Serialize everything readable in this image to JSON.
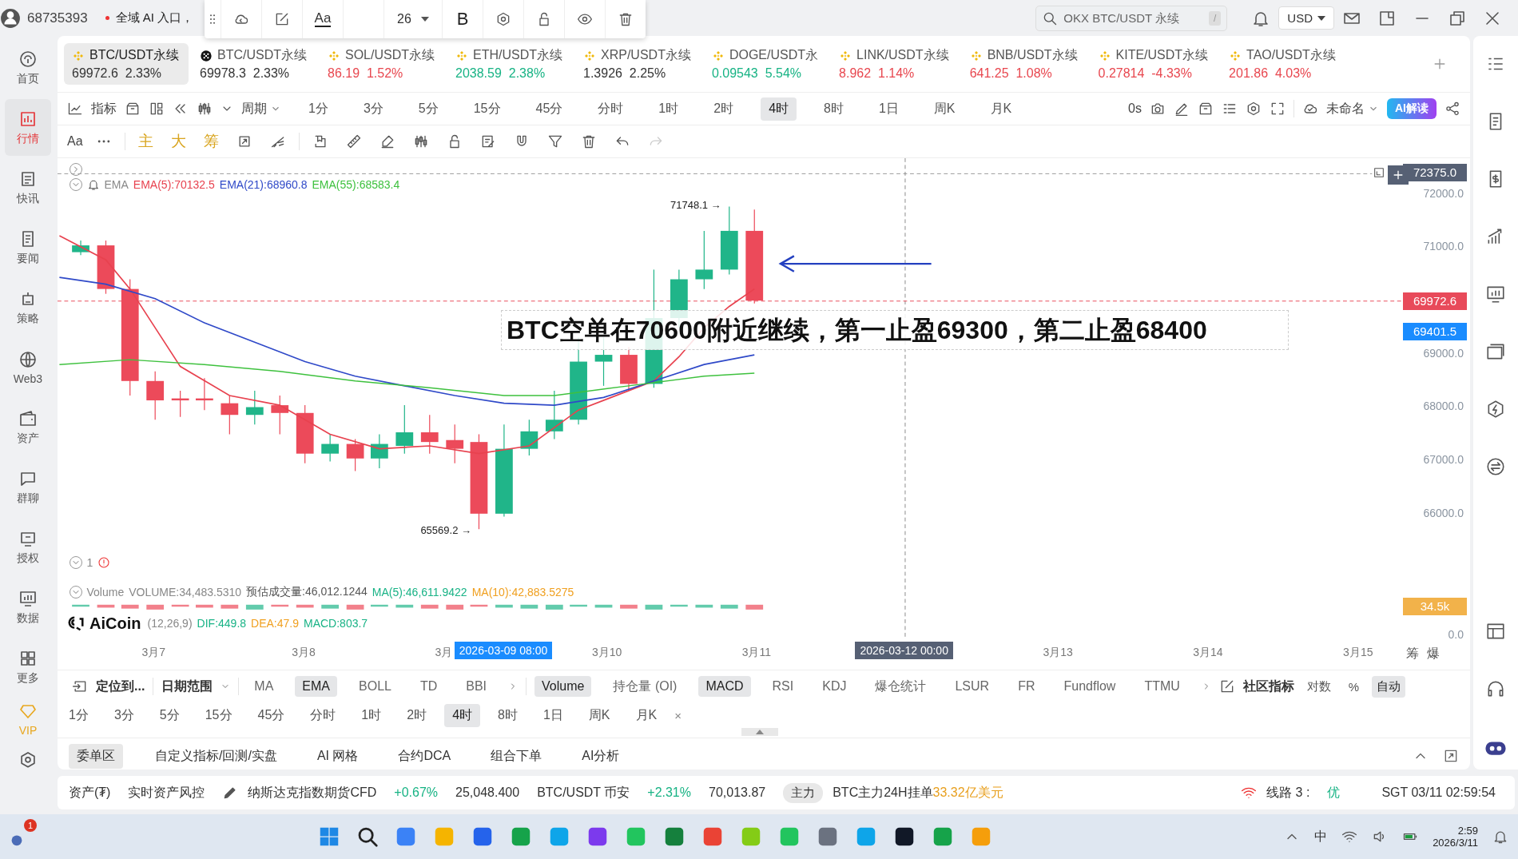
{
  "top_bar": {
    "account_id": "68735393",
    "notice": "全域 AI 入口，"
  },
  "format_toolbar": {
    "font_label": "Aa",
    "font_size": "26",
    "bold": "B"
  },
  "search": {
    "placeholder": "OKX BTC/USDT 永续",
    "shortcut": "/"
  },
  "currency": "USD",
  "sidebar": {
    "items": [
      {
        "label": "首页",
        "selected": false
      },
      {
        "label": "行情",
        "selected": true
      },
      {
        "label": "快讯",
        "selected": false
      },
      {
        "label": "要闻",
        "selected": false
      },
      {
        "label": "策略",
        "selected": false
      },
      {
        "label": "Web3",
        "selected": false
      },
      {
        "label": "资产",
        "selected": false
      },
      {
        "label": "群聊",
        "selected": false
      },
      {
        "label": "授权",
        "selected": false
      },
      {
        "label": "数据",
        "selected": false
      },
      {
        "label": "更多",
        "selected": false
      }
    ],
    "vip": "VIP"
  },
  "tickers": [
    {
      "kind": "binance",
      "name": "BTC/USDT永续",
      "price": "69972.6",
      "change": "2.33%",
      "color": "#333333",
      "selected": true
    },
    {
      "kind": "okx",
      "name": "BTC/USDT永续",
      "price": "69978.3",
      "change": "2.33%",
      "color": "#333333",
      "selected": false
    },
    {
      "kind": "binance",
      "name": "SOL/USDT永续",
      "price": "86.19",
      "change": "1.52%",
      "color": "#e8474f",
      "selected": false
    },
    {
      "kind": "binance",
      "name": "ETH/USDT永续",
      "price": "2038.59",
      "change": "2.38%",
      "color": "#17b384",
      "selected": false
    },
    {
      "kind": "binance",
      "name": "XRP/USDT永续",
      "price": "1.3926",
      "change": "2.25%",
      "color": "#333333",
      "selected": false
    },
    {
      "kind": "binance",
      "name": "DOGE/USDT永",
      "price": "0.09543",
      "change": "5.54%",
      "color": "#17b384",
      "selected": false
    },
    {
      "kind": "binance",
      "name": "LINK/USDT永续",
      "price": "8.962",
      "change": "1.14%",
      "color": "#e8474f",
      "selected": false
    },
    {
      "kind": "binance",
      "name": "BNB/USDT永续",
      "price": "641.25",
      "change": "1.08%",
      "color": "#e8474f",
      "selected": false
    },
    {
      "kind": "binance",
      "name": "KITE/USDT永续",
      "price": "0.27814",
      "change": "-4.33%",
      "color": "#e8474f",
      "selected": false
    },
    {
      "kind": "binance",
      "name": "TAO/USDT永续",
      "price": "201.86",
      "change": "4.03%",
      "color": "#e8474f",
      "selected": false
    }
  ],
  "chart_toolbar": {
    "indicators": "指标",
    "period": "周期",
    "periods": [
      {
        "label": "1分",
        "selected": false
      },
      {
        "label": "3分",
        "selected": false
      },
      {
        "label": "5分",
        "selected": false
      },
      {
        "label": "15分",
        "selected": false
      },
      {
        "label": "45分",
        "selected": false
      },
      {
        "label": "分时",
        "selected": false
      },
      {
        "label": "1时",
        "selected": false
      },
      {
        "label": "2时",
        "selected": false
      },
      {
        "label": "4时",
        "selected": true
      },
      {
        "label": "8时",
        "selected": false
      },
      {
        "label": "1日",
        "selected": false
      },
      {
        "label": "周K",
        "selected": false
      },
      {
        "label": "月K",
        "selected": false
      }
    ],
    "countdown": "0s",
    "template": "未命名",
    "ai": "AI解读"
  },
  "draw_toolbar": {
    "font": "Aa",
    "modes": [
      "主",
      "大",
      "筹"
    ]
  },
  "chart": {
    "ema_legend": {
      "name": "EMA",
      "values": [
        {
          "text": "EMA(5):70132.5",
          "color": "#e8424f"
        },
        {
          "text": "EMA(21):68960.8",
          "color": "#2f49c8"
        },
        {
          "text": "EMA(55):68583.4",
          "color": "#3ec13e"
        }
      ]
    },
    "high_label": "71748.1 →",
    "low_label": "65569.2 →",
    "annotation": "BTC空单在70600附近继续，第一止盈69300，第二止盈68400",
    "pane_index": "1",
    "volume_legend": [
      {
        "text": "Volume",
        "color": "#888888"
      },
      {
        "text": "VOLUME:34,483.5310",
        "color": "#888888"
      },
      {
        "text": "预估成交量:46,012.1244",
        "color": "#555555"
      },
      {
        "text": "MA(5):46,611.9422",
        "color": "#19b386"
      },
      {
        "text": "MA(10):42,883.5275",
        "color": "#f0a020"
      }
    ],
    "logo": "AiCoin",
    "macd_legend": [
      {
        "text": "(12,26,9)",
        "color": "#888888"
      },
      {
        "text": "DIF:449.8",
        "color": "#19b386"
      },
      {
        "text": "DEA:47.9",
        "color": "#f0a020"
      },
      {
        "text": "MACD:803.7",
        "color": "#19b386"
      }
    ],
    "x_labels": [
      "3月7",
      "3月8",
      "3月",
      "3月10",
      "3月11",
      "3月13",
      "3月14",
      "3月15"
    ],
    "crosshair_times": [
      {
        "text": "2026-03-09 08:00",
        "kind": "cursor"
      },
      {
        "text": "2026-03-12 00:00",
        "kind": "crosshair"
      }
    ],
    "price_ticks": [
      "72000.0",
      "71000.0",
      "69000.0",
      "68000.0",
      "67000.0",
      "66000.0"
    ],
    "price_badges": [
      {
        "text": "72375.0",
        "kind": "crosshair"
      },
      {
        "text": "69972.6",
        "kind": "last"
      },
      {
        "text": "69401.5",
        "kind": "ema"
      }
    ],
    "volume_badge": "34.5k",
    "volume_zero": "0.0",
    "axis_buttons": [
      "筹",
      "爆"
    ]
  },
  "indicator_bar": {
    "locate": "定位到...",
    "date_range": "日期范围",
    "main": [
      {
        "label": "MA",
        "selected": false
      },
      {
        "label": "EMA",
        "selected": true
      },
      {
        "label": "BOLL",
        "selected": false
      },
      {
        "label": "TD",
        "selected": false
      },
      {
        "label": "BBI",
        "selected": false
      }
    ],
    "sub": [
      {
        "label": "Volume",
        "selected": true
      },
      {
        "label": "持仓量 (OI)",
        "selected": false
      },
      {
        "label": "MACD",
        "selected": true
      },
      {
        "label": "RSI",
        "selected": false
      },
      {
        "label": "KDJ",
        "selected": false
      },
      {
        "label": "爆仓统计",
        "selected": false
      },
      {
        "label": "LSUR",
        "selected": false
      },
      {
        "label": "FR",
        "selected": false
      },
      {
        "label": "Fundflow",
        "selected": false
      },
      {
        "label": "TTMU",
        "selected": false
      }
    ],
    "community": "社区指标",
    "options": [
      {
        "label": "对数",
        "selected": false
      },
      {
        "label": "%",
        "selected": false
      },
      {
        "label": "自动",
        "selected": true
      }
    ]
  },
  "period_row": {
    "periods": [
      {
        "label": "1分",
        "selected": false
      },
      {
        "label": "3分",
        "selected": false
      },
      {
        "label": "5分",
        "selected": false
      },
      {
        "label": "15分",
        "selected": false
      },
      {
        "label": "45分",
        "selected": false
      },
      {
        "label": "分时",
        "selected": false
      },
      {
        "label": "1时",
        "selected": false
      },
      {
        "label": "2时",
        "selected": false
      },
      {
        "label": "4时",
        "selected": true
      },
      {
        "label": "8时",
        "selected": false
      },
      {
        "label": "1日",
        "selected": false
      },
      {
        "label": "周K",
        "selected": false
      },
      {
        "label": "月K",
        "selected": false
      }
    ],
    "close": "×"
  },
  "bottom_tabs": [
    {
      "label": "委单区",
      "selected": true
    },
    {
      "label": "自定义指标/回测/实盘",
      "selected": false
    },
    {
      "label": "AI 网格",
      "selected": false
    },
    {
      "label": "合约DCA",
      "selected": false
    },
    {
      "label": "组合下单",
      "selected": false
    },
    {
      "label": "AI分析",
      "selected": false
    }
  ],
  "status_bar": {
    "assets": "资产(₮)",
    "risk": "实时资产风控",
    "markets": [
      {
        "name": "纳斯达克指数期货CFD",
        "change": "+0.67%",
        "price": "25,048.400"
      },
      {
        "name": "BTC/USDT 币安",
        "change": "+2.31%",
        "price": "70,013.87"
      }
    ],
    "tag": "主力",
    "orders_label": "BTC主力24H挂单",
    "orders_value": "33.32亿美元",
    "line_label": "线路 3 :",
    "line_quality": "优",
    "clock": "SGT 03/11 02:59:54"
  },
  "taskbar": {
    "badge": "1",
    "ime": "中",
    "time": "2:59",
    "date": "2026/3/11"
  }
}
